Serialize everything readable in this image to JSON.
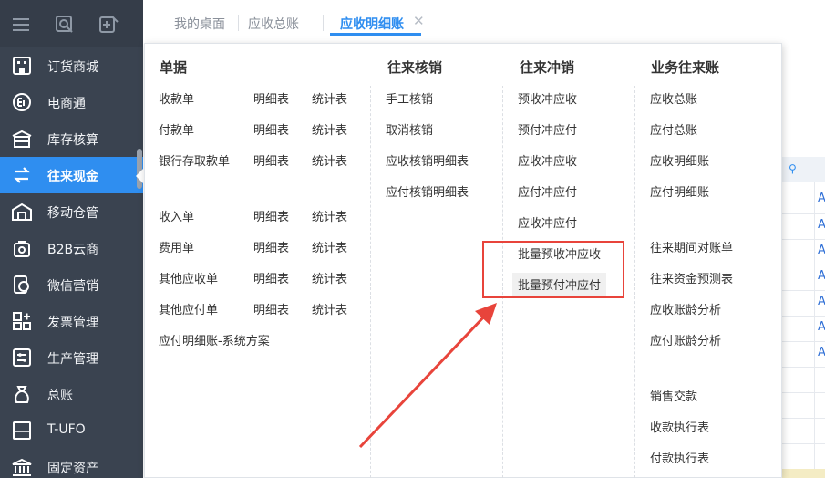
{
  "sidebar": {
    "items": [
      {
        "label": "订货商城",
        "icon": "store-icon"
      },
      {
        "label": "电商通",
        "icon": "ecommerce-icon"
      },
      {
        "label": "库存核算",
        "icon": "inventory-icon"
      },
      {
        "label": "往来现金",
        "icon": "exchange-icon",
        "active": true
      },
      {
        "label": "移动仓管",
        "icon": "warehouse-icon"
      },
      {
        "label": "B2B云商",
        "icon": "cloud-shop-icon"
      },
      {
        "label": "微信营销",
        "icon": "wechat-marketing-icon"
      },
      {
        "label": "发票管理",
        "icon": "invoice-icon"
      },
      {
        "label": "生产管理",
        "icon": "production-icon"
      },
      {
        "label": "总账",
        "icon": "ledger-icon"
      },
      {
        "label": "T-UFO",
        "icon": "ufo-icon"
      },
      {
        "label": "固定资产",
        "icon": "fixed-asset-icon"
      }
    ]
  },
  "tabs": [
    {
      "label": "我的桌面"
    },
    {
      "label": "应收总账"
    },
    {
      "label": "应收明细账",
      "active": true
    }
  ],
  "tab_close": "✕",
  "menu": {
    "col1": {
      "title": "单据",
      "rows": [
        [
          "收款单",
          "明细表",
          "统计表"
        ],
        [
          "付款单",
          "明细表",
          "统计表"
        ],
        [
          "银行存取款单",
          "明细表",
          "统计表"
        ],
        [
          "收入单",
          "明细表",
          "统计表"
        ],
        [
          "费用单",
          "明细表",
          "统计表"
        ],
        [
          "其他应收单",
          "明细表",
          "统计表"
        ],
        [
          "其他应付单",
          "明细表",
          "统计表"
        ]
      ],
      "last": "应付明细账-系统方案"
    },
    "col2": {
      "title": "往来核销",
      "items": [
        "手工核销",
        "取消核销",
        "应收核销明细表",
        "应付核销明细表"
      ]
    },
    "col3": {
      "title": "往来冲销",
      "items": [
        "预收冲应收",
        "预付冲应付",
        "应收冲应收",
        "应付冲应付",
        "应收冲应付",
        "批量预收冲应收",
        "批量预付冲应付"
      ]
    },
    "col4": {
      "title": "业务往来账",
      "items": [
        "应收总账",
        "应付总账",
        "应收明细账",
        "应付明细账",
        "往来期间对账单",
        "往来资金预测表",
        "应收账龄分析",
        "应付账龄分析",
        "销售交款",
        "收款执行表",
        "付款执行表"
      ]
    }
  },
  "background_table": {
    "cells": [
      "A",
      "A",
      "A",
      "A",
      "A",
      "A",
      "A"
    ]
  },
  "colors": {
    "sidebar_bg": "#3a4350",
    "accent": "#2f8ef0",
    "annotation_red": "#e8443b"
  }
}
